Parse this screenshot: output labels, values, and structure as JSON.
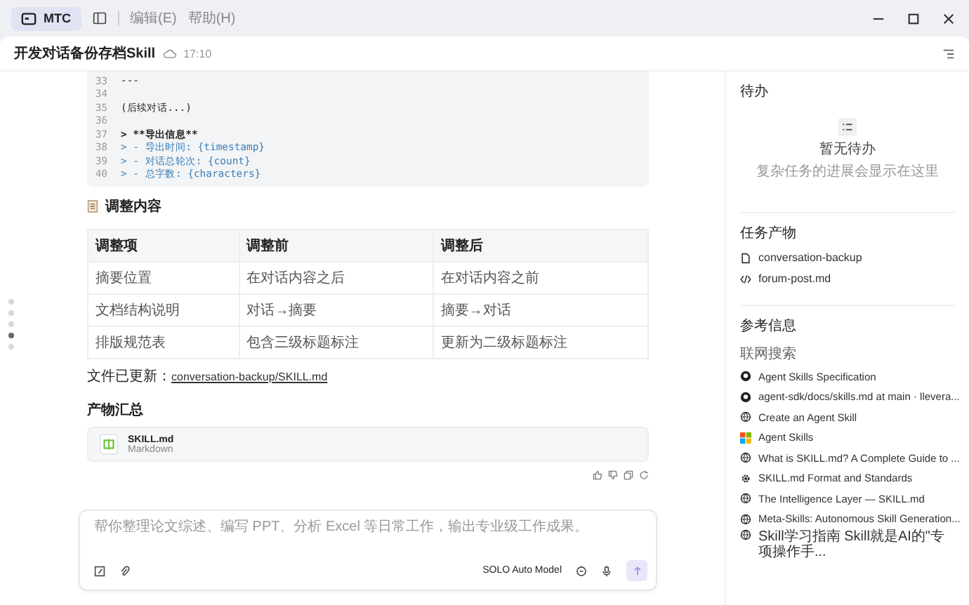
{
  "app": {
    "name": "MTC",
    "menu": [
      "编辑(E)",
      "帮助(H)"
    ]
  },
  "conversation": {
    "title": "开发对话备份存档Skill",
    "time": "17:10"
  },
  "code_block": {
    "lines": [
      {
        "number": "33",
        "text": "---",
        "kind": "plain"
      },
      {
        "number": "34"
      },
      {
        "number": "35",
        "text": "(后续对话...)",
        "kind": "plain"
      },
      {
        "number": "36"
      },
      {
        "number": "37",
        "text": "> **导出信息**",
        "kind": "bold"
      },
      {
        "number": "38",
        "text": "> - 导出时间: {timestamp}",
        "kind": "quote"
      },
      {
        "number": "39",
        "text": "> - 对话总轮次: {count}",
        "kind": "quote"
      },
      {
        "number": "40",
        "text": "> - 总字数: {characters}",
        "kind": "quote"
      }
    ]
  },
  "section_heading": "调整内容",
  "table": {
    "columns": [
      "调整项",
      "调整前",
      "调整后"
    ],
    "rows": [
      [
        "摘要位置",
        "在对话内容之后",
        "在对话内容之前"
      ],
      [
        "文档结构说明",
        "对话→摘要",
        "摘要→对话"
      ],
      [
        "排版规范表",
        "包含三级标题标注",
        "更新为二级标题标注"
      ]
    ]
  },
  "file_updated": {
    "label": "文件已更新：",
    "link": "conversation-backup/SKILL.md"
  },
  "artifacts_heading": "产物汇总",
  "artifact": {
    "name": "SKILL.md",
    "type": "Markdown"
  },
  "page_dots": [
    {
      "selected": false
    },
    {
      "selected": false
    },
    {
      "selected": false
    },
    {
      "selected": true
    },
    {
      "selected": false
    }
  ],
  "input": {
    "placeholder": "帮你整理论文综述、编写 PPT、分析 Excel 等日常工作，输出专业级工作成果。",
    "model": "SOLO Auto Model"
  },
  "sidebar": {
    "todo": {
      "title": "待办",
      "empty_title": "暂无待办",
      "empty_hint": "复杂任务的进展会显示在这里"
    },
    "outputs": {
      "title": "任务产物",
      "items": [
        {
          "label": "conversation-backup",
          "kind": "file"
        },
        {
          "label": "forum-post.md",
          "kind": "code"
        }
      ]
    },
    "references": {
      "title": "参考信息",
      "subtitle": "联网搜索",
      "items": [
        {
          "label": "Agent Skills Specification",
          "kind": "github"
        },
        {
          "label": "agent-sdk/docs/skills.md at main · llevera...",
          "kind": "github"
        },
        {
          "label": "Create an Agent Skill",
          "kind": "globe"
        },
        {
          "label": "Agent Skills",
          "kind": "windows"
        },
        {
          "label": "What is SKILL.md? A Complete Guide to ...",
          "kind": "globe"
        },
        {
          "label": "SKILL.md Format and Standards",
          "kind": "gear"
        },
        {
          "label": "The Intelligence Layer — SKILL.md",
          "kind": "globe"
        },
        {
          "label": "Meta-Skills: Autonomous Skill Generation...",
          "kind": "globe"
        },
        {
          "label": "Skill学习指南 Skill就是AI的\"专项操作手...",
          "kind": "globe"
        }
      ]
    }
  }
}
